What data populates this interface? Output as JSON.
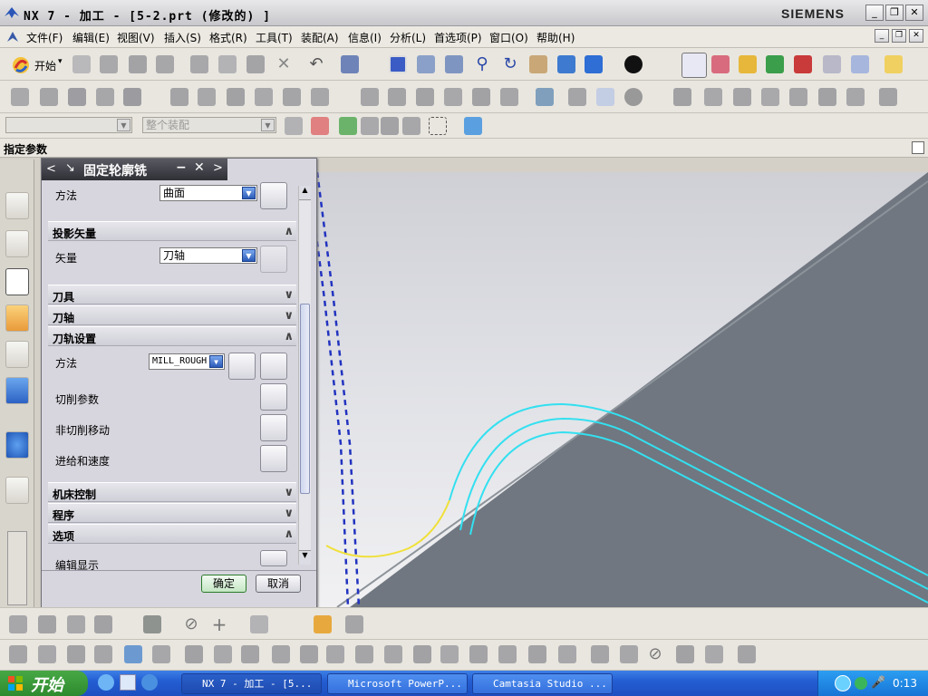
{
  "window": {
    "title": "NX 7 - 加工 - [5-2.prt  (修改的) ]",
    "brand": "SIEMENS",
    "controls": [
      "_",
      "❐",
      "✕"
    ]
  },
  "menubar": {
    "items": [
      "文件(F)",
      "编辑(E)",
      "视图(V)",
      "插入(S)",
      "格式(R)",
      "工具(T)",
      "装配(A)",
      "信息(I)",
      "分析(L)",
      "首选项(P)",
      "窗口(O)",
      "帮助(H)"
    ]
  },
  "toolbar": {
    "start_label": "开始",
    "filter_placeholder": "",
    "assembly_select": "整个装配"
  },
  "statusbar": {
    "prompt": "指定参数"
  },
  "dialog": {
    "title": "固定轮廓铣",
    "sections": {
      "method_row_label": "方法",
      "method_row_value": "曲面",
      "projection": "投影矢量",
      "vector_label": "矢量",
      "vector_value": "刀轴",
      "tool": "刀具",
      "tool_axis": "刀轴",
      "path_settings": "刀轨设置",
      "path_method_label": "方法",
      "path_method_value": "MILL_ROUGH",
      "cut_params": "切削参数",
      "non_cut_moves": "非切削移动",
      "feeds_speeds": "进给和速度",
      "machine_control": "机床控制",
      "program": "程序",
      "options": "选项",
      "edit_display": "编辑显示"
    },
    "ok": "确定",
    "cancel": "取消"
  },
  "taskbar": {
    "start": "开始",
    "tasks": [
      "NX 7 - 加工 - [5...",
      "Microsoft PowerP...",
      "Camtasia Studio ..."
    ],
    "clock": "0:13"
  },
  "colors": {
    "toolpath": "#33e0f0",
    "engage": "#f0e03a",
    "boundary": "#2233c0",
    "part_shade": "#707780"
  }
}
